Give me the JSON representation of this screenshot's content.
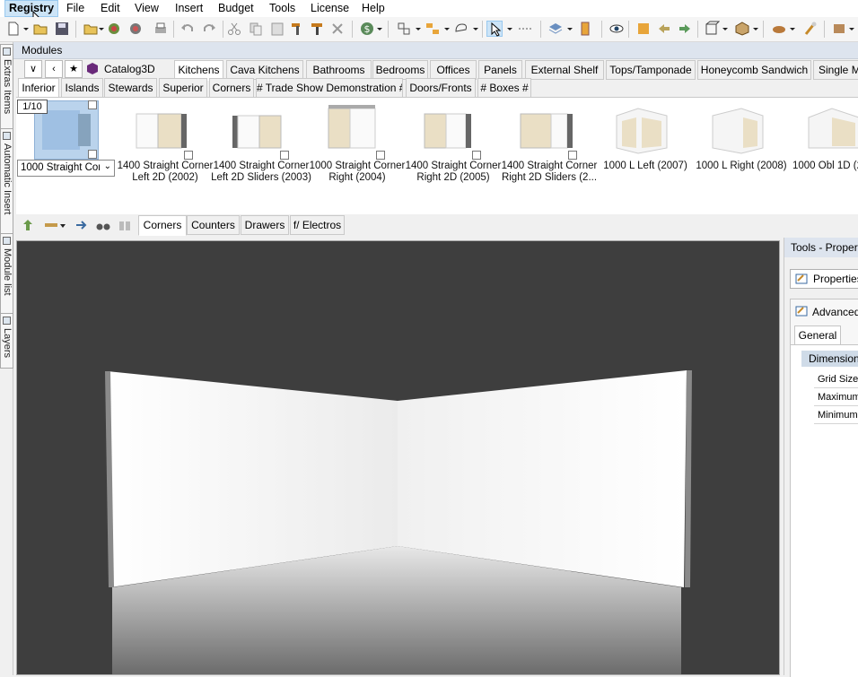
{
  "menubar": {
    "items": [
      "Registry",
      "File",
      "Edit",
      "View",
      "Insert",
      "Budget",
      "Tools",
      "License",
      "Help"
    ],
    "active": "Registry"
  },
  "sidetabs": [
    "Extras Items",
    "Automatic Insert",
    "Module list",
    "Layers"
  ],
  "modules": {
    "title": "Modules",
    "catalog_label": "Catalog3D",
    "top_tabs": [
      "Kitchens",
      "Cava Kitchens",
      "Bathrooms",
      "Bedrooms",
      "Offices",
      "Panels",
      "External Shelf",
      "Tops/Tamponade",
      "Honeycomb Sandwich",
      "Single M"
    ],
    "selected_top_tab": "Kitchens",
    "sub_tabs": [
      "Inferior",
      "Islands",
      "Stewards",
      "Superior",
      "Corners",
      "# Trade Show Demonstration #",
      "Doors/Fronts",
      "# Boxes #"
    ],
    "selected_sub_tab": "Inferior",
    "page_indicator": "1/10",
    "selected_item_value": "1000 Straight Corn",
    "items": [
      "1400 Straight Corner Left 2D (2002)",
      "1400 Straight Corner Left 2D Sliders (2003)",
      "1000 Straight Corner Right (2004)",
      "1400 Straight Corner Right 2D (2005)",
      "1400 Straight Corner Right 2D Sliders (2...",
      "1000 L Left (2007)",
      "1000 L Right (2008)",
      "1000 Obl 1D (2"
    ]
  },
  "lower_tabs": [
    "Corners",
    "Counters",
    "Drawers",
    "f/ Electros"
  ],
  "selected_lower_tab": "Corners",
  "tools_panel": {
    "title": "Tools - Propert",
    "properties_button": "Properties",
    "advanced_label": "Advanced",
    "general_tab": "General",
    "section": "Dimension",
    "rows": [
      "Grid Size",
      "Maximum",
      "Minimum"
    ]
  },
  "colors": {
    "viewport_bg": "#3e3e3e",
    "accent": "#cce4f7",
    "panel_header": "#dde4ee"
  },
  "icons": [
    "new-icon",
    "open-icon",
    "save-icon",
    "print-icon",
    "undo-icon",
    "redo-icon",
    "cut-icon",
    "copy-icon",
    "paste-icon",
    "hammer-icon",
    "brush-icon",
    "delete-icon",
    "budget-icon",
    "layout-icon",
    "group-icon",
    "lasso-icon",
    "pointer-icon",
    "measure-icon",
    "layers-icon",
    "eye-icon",
    "sync-icon",
    "back-icon",
    "forward-icon",
    "box-icon",
    "package-icon",
    "wand-icon",
    "settings-icon"
  ]
}
